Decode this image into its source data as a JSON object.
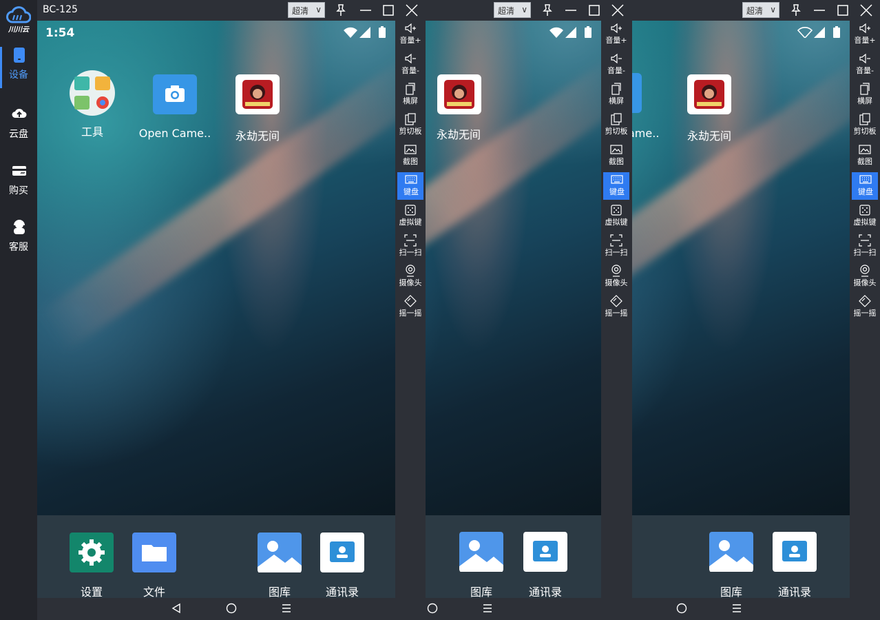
{
  "app": {
    "logo_text": "川川云",
    "sidebar": [
      {
        "label": "设备",
        "icon": "device-icon",
        "active": true
      },
      {
        "label": "云盘",
        "icon": "cloud-upload-icon",
        "active": false
      },
      {
        "label": "购买",
        "icon": "card-icon",
        "active": false
      },
      {
        "label": "客服",
        "icon": "support-icon",
        "active": false
      }
    ]
  },
  "windows": [
    {
      "title": "BC-125",
      "quality": "超清",
      "time": "1:54"
    },
    {
      "title": "",
      "quality": "超清",
      "time": ""
    },
    {
      "title": "",
      "quality": "超清",
      "time": ""
    }
  ],
  "home_apps": {
    "tools": "工具",
    "camera": "Open Came..",
    "camera_partial": "ame..",
    "game": "永劫无间"
  },
  "dock": {
    "settings": "设置",
    "files": "文件",
    "gallery": "图库",
    "contacts": "通讯录"
  },
  "toolbar": [
    {
      "label": "音量+",
      "icon": "volume-up-icon"
    },
    {
      "label": "音量-",
      "icon": "volume-down-icon"
    },
    {
      "label": "横屏",
      "icon": "rotate-icon"
    },
    {
      "label": "剪切板",
      "icon": "clipboard-icon"
    },
    {
      "label": "截图",
      "icon": "screenshot-icon"
    },
    {
      "label": "键盘",
      "icon": "keyboard-icon",
      "active": true
    },
    {
      "label": "虚拟键",
      "icon": "virtual-keys-icon"
    },
    {
      "label": "扫一扫",
      "icon": "scan-icon"
    },
    {
      "label": "摄像头",
      "icon": "camera-icon"
    },
    {
      "label": "摇一摇",
      "icon": "shake-icon"
    }
  ],
  "colors": {
    "accent": "#2f7bf1",
    "window_bg": "#2d3037",
    "sidebar_bg": "#23252b"
  }
}
